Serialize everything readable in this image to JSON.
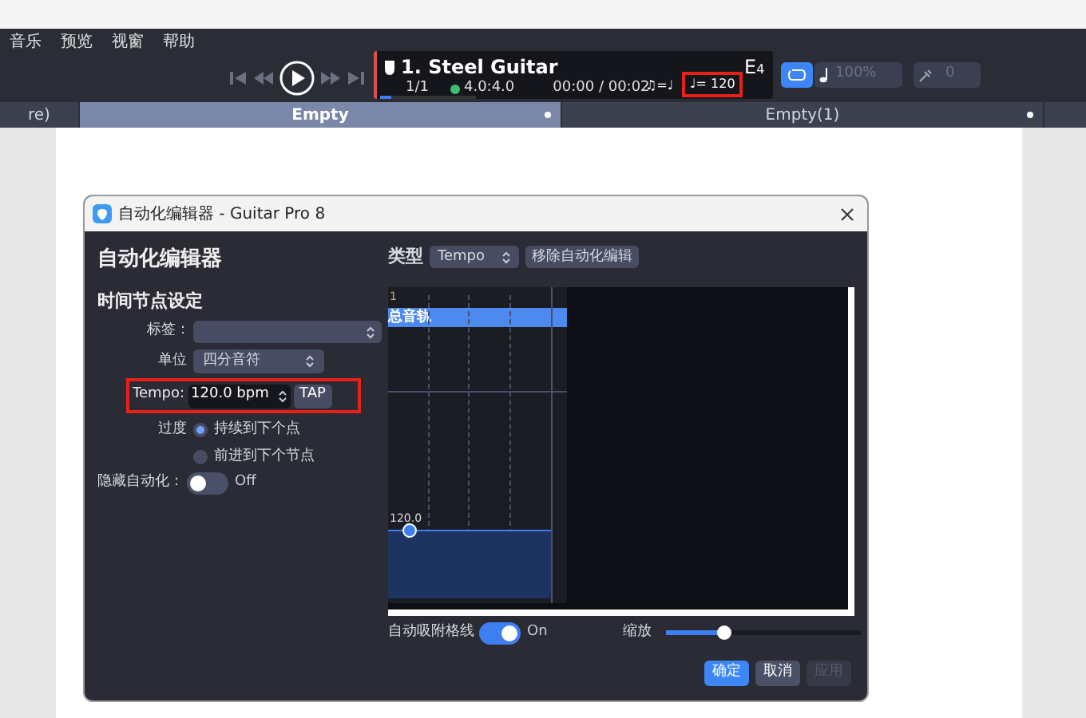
{
  "menu": [
    "音乐",
    "预览",
    "视窗",
    "帮助"
  ],
  "player": {
    "track": "1. Steel Guitar",
    "bar": "1/1",
    "signature": "4.0:4.0",
    "time": "00:00 / 00:02",
    "note_eq": "♫=♩",
    "tempo": "♩= 120",
    "key": "E",
    "key_sub": "4",
    "volume": "100%",
    "pitch": "0"
  },
  "doc_tabs": [
    {
      "label": "re)",
      "selected": false
    },
    {
      "label": "Empty",
      "selected": true
    },
    {
      "label": "Empty(1)",
      "selected": false
    }
  ],
  "dialog": {
    "title": "自动化编辑器 - Guitar Pro 8",
    "heading": "自动化编辑器",
    "section": "时间节点设定",
    "label_field": {
      "label": "标签："
    },
    "unit": {
      "label": "单位",
      "value": "四分音符"
    },
    "tempo": {
      "label": "Tempo:",
      "value": "120.0 bpm",
      "tap": "TAP"
    },
    "transition": {
      "label": "过度",
      "options": [
        {
          "label": "持续到下个点",
          "selected": true
        },
        {
          "label": "前进到下个节点",
          "selected": false
        }
      ]
    },
    "hide": {
      "label": "隐藏自动化：",
      "on": false,
      "state": "Off"
    },
    "type": {
      "label": "类型",
      "value": "Tempo",
      "remove": "移除自动化编辑"
    },
    "editor": {
      "bar_number": "1",
      "track": "总音轨",
      "point_label": "120.0"
    },
    "snap": {
      "label": "自动吸附格线",
      "on": true,
      "state": "On"
    },
    "zoom": {
      "label": "缩放",
      "level": 0.3
    },
    "buttons": [
      {
        "label": "确定",
        "kind": "primary",
        "disabled": false
      },
      {
        "label": "取消",
        "kind": "secondary",
        "disabled": false
      },
      {
        "label": "应用",
        "kind": "secondary",
        "disabled": true
      }
    ]
  }
}
